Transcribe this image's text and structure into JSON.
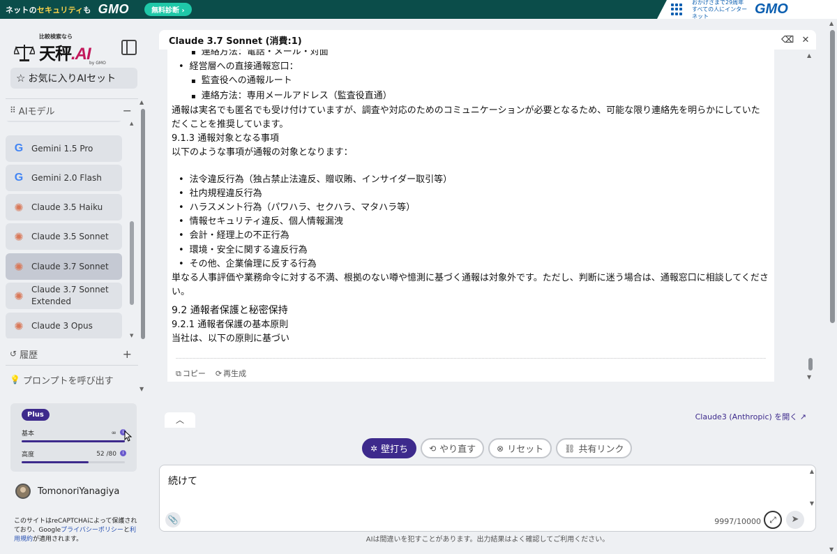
{
  "banner": {
    "tagline_pre": "ネットの",
    "tagline_hl": "セキュリティ",
    "tagline_post": "も",
    "logo": "GMO",
    "diag_button": "無料診断 ›",
    "right_text_1": "おかげさまで29周年",
    "right_text_2": "すべての人にインターネット",
    "right_logo": "GMO"
  },
  "sidebar": {
    "logo_sub": "比較検索なら",
    "logo_main": "天秤",
    "logo_ai": ".AI",
    "logo_by": "by GMO",
    "fav_button": "お気に入りAIセット",
    "models_heading": "AIモデル",
    "models": [
      {
        "label": "Gemini 1.5 Pro",
        "icon": "google-g-icon"
      },
      {
        "label": "Gemini 2.0 Flash",
        "icon": "google-g-icon"
      },
      {
        "label": "Claude 3.5 Haiku",
        "icon": "claude-burst-icon"
      },
      {
        "label": "Claude 3.5 Sonnet",
        "icon": "claude-burst-icon"
      },
      {
        "label": "Claude 3.7 Sonnet",
        "icon": "claude-burst-icon",
        "active": true
      },
      {
        "label": "Claude 3.7 Sonnet Extended",
        "icon": "claude-burst-icon"
      },
      {
        "label": "Claude 3 Opus",
        "icon": "claude-burst-icon"
      }
    ],
    "history_heading": "履歴",
    "prompt_heading": "プロンプトを呼び出す",
    "plan": {
      "badge": "Plus",
      "basic_label": "基本",
      "basic_value": "∞",
      "basic_fill": 1.0,
      "advanced_label": "高度",
      "advanced_value": "52 /80",
      "advanced_fill": 0.65
    },
    "user_name": "TomonoriYanagiya",
    "recaptcha_1": "このサイトはreCAPTCHAによって保護されており、Google",
    "recaptcha_privacy": "プライバシーポリシー",
    "recaptcha_2": "と",
    "recaptcha_terms": "利用規約",
    "recaptcha_3": "が適用されます。"
  },
  "chat": {
    "header_title": "Claude 3.7 Sonnet (消費:1)",
    "lines": [
      {
        "type": "bul2",
        "text": "連絡方法：電話・メール・対面"
      },
      {
        "type": "bul",
        "text": "経営層への直接通報窓口："
      },
      {
        "type": "bul2",
        "text": "監査役への通報ルート"
      },
      {
        "type": "bul2",
        "text": "連絡方法：専用メールアドレス（監査役直通）"
      },
      {
        "type": "wrap",
        "text": "通報は実名でも匿名でも受け付けていますが、調査や対応のためのコミュニケーションが必要となるため、可能な限り連絡先を明らかにしていただくことを推奨しています。"
      },
      {
        "type": "line",
        "text": "9.1.3 通報対象となる事項"
      },
      {
        "type": "line",
        "text": "以下のような事項が通報の対象となります："
      },
      {
        "type": "blank",
        "text": ""
      },
      {
        "type": "bul",
        "text": "法令違反行為（独占禁止法違反、贈収賄、インサイダー取引等）"
      },
      {
        "type": "bul",
        "text": "社内規程違反行為"
      },
      {
        "type": "bul",
        "text": "ハラスメント行為（パワハラ、セクハラ、マタハラ等）"
      },
      {
        "type": "bul",
        "text": "情報セキュリティ違反、個人情報漏洩"
      },
      {
        "type": "bul",
        "text": "会計・経理上の不正行為"
      },
      {
        "type": "bul",
        "text": "環境・安全に関する違反行為"
      },
      {
        "type": "bul",
        "text": "その他、企業倫理に反する行為"
      },
      {
        "type": "wrap",
        "text": "単なる人事評価や業務命令に対する不満、根拠のない噂や憶測に基づく通報は対象外です。ただし、判断に迷う場合は、通報窓口に相談してください。"
      },
      {
        "type": "h2",
        "text": "9.2 通報者保護と秘密保持"
      },
      {
        "type": "line",
        "text": "9.2.1 通報者保護の基本原則"
      },
      {
        "type": "line",
        "text": "当社は、以下の原則に基づい"
      }
    ],
    "copy_label": "コピー",
    "regen_label": "再生成",
    "open_link": "Claude3 (Anthropic) を開く"
  },
  "actions": {
    "brainstorm": "壁打ち",
    "redo": "やり直す",
    "reset": "リセット",
    "share": "共有リンク"
  },
  "input": {
    "value": "続けて",
    "counter": "9997/10000"
  },
  "disclaimer": "AIは間違いを犯すことがあります。出力結果はよく確認してご利用ください。"
}
